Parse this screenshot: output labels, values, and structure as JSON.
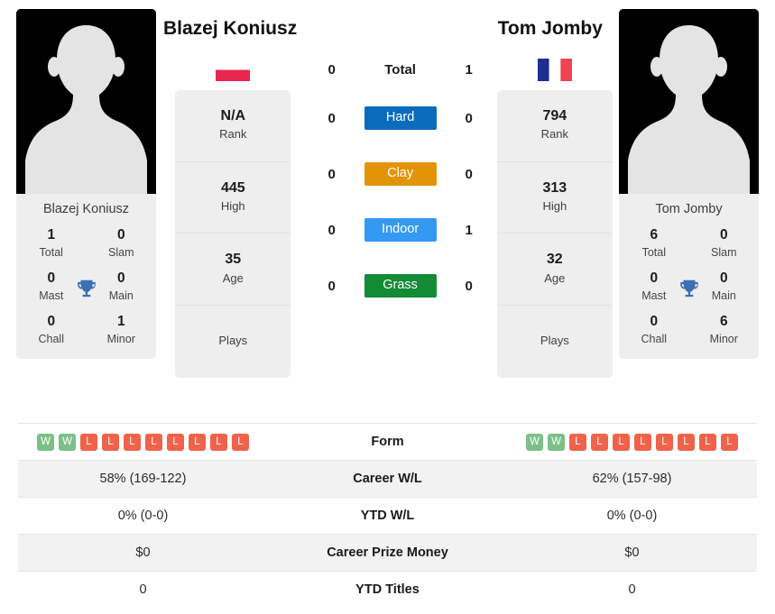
{
  "colors": {
    "hard": "#0b6cbd",
    "clay": "#e39406",
    "indoor": "#3399f3",
    "grass": "#138a36",
    "win": "#7cc087",
    "loss": "#f0634a",
    "trophy": "#3d6fb4",
    "card_bg": "#eeeeee",
    "row_shade": "#f2f2f2"
  },
  "players": {
    "left": {
      "name": "Blazej Koniusz",
      "photo_caption": "Blazej Koniusz",
      "avatar_icon": "person-silhouette-icon",
      "flag": {
        "name": "poland-flag-icon",
        "country": "Poland",
        "bands": [
          "#ffffff",
          "#e8274f"
        ],
        "orientation": "horizontal"
      },
      "titles": [
        {
          "value": "1",
          "label": "Total"
        },
        {
          "value": "0",
          "label": "Slam"
        },
        {
          "value": "0",
          "label": "Mast"
        },
        {
          "value": "0",
          "label": "Main"
        },
        {
          "value": "0",
          "label": "Chall"
        },
        {
          "value": "1",
          "label": "Minor"
        }
      ],
      "stats": [
        {
          "value": "N/A",
          "label": "Rank"
        },
        {
          "value": "445",
          "label": "High"
        },
        {
          "value": "35",
          "label": "Age"
        },
        {
          "value": "",
          "label": "Plays"
        }
      ],
      "h2h": {
        "total": "0",
        "hard": "0",
        "clay": "0",
        "indoor": "0",
        "grass": "0"
      },
      "form": [
        "W",
        "W",
        "L",
        "L",
        "L",
        "L",
        "L",
        "L",
        "L",
        "L"
      ],
      "career_wl": "58% (169-122)",
      "ytd_wl": "0% (0-0)",
      "career_prize_money": "$0",
      "ytd_titles": "0"
    },
    "right": {
      "name": "Tom Jomby",
      "photo_caption": "Tom Jomby",
      "avatar_icon": "person-silhouette-icon",
      "flag": {
        "name": "france-flag-icon",
        "country": "France",
        "bands": [
          "#1c2f93",
          "#ffffff",
          "#ef4452"
        ],
        "orientation": "vertical"
      },
      "titles": [
        {
          "value": "6",
          "label": "Total"
        },
        {
          "value": "0",
          "label": "Slam"
        },
        {
          "value": "0",
          "label": "Mast"
        },
        {
          "value": "0",
          "label": "Main"
        },
        {
          "value": "0",
          "label": "Chall"
        },
        {
          "value": "6",
          "label": "Minor"
        }
      ],
      "stats": [
        {
          "value": "794",
          "label": "Rank"
        },
        {
          "value": "313",
          "label": "High"
        },
        {
          "value": "32",
          "label": "Age"
        },
        {
          "value": "",
          "label": "Plays"
        }
      ],
      "h2h": {
        "total": "1",
        "hard": "0",
        "clay": "0",
        "indoor": "1",
        "grass": "0"
      },
      "form": [
        "W",
        "W",
        "L",
        "L",
        "L",
        "L",
        "L",
        "L",
        "L",
        "L"
      ],
      "career_wl": "62% (157-98)",
      "ytd_wl": "0% (0-0)",
      "career_prize_money": "$0",
      "ytd_titles": "0"
    }
  },
  "surfaces": {
    "total_label": "Total",
    "hard_label": "Hard",
    "clay_label": "Clay",
    "indoor_label": "Indoor",
    "grass_label": "Grass"
  },
  "table": {
    "form_label": "Form",
    "career_wl_label": "Career W/L",
    "ytd_wl_label": "YTD W/L",
    "career_prize_money_label": "Career Prize Money",
    "ytd_titles_label": "YTD Titles"
  }
}
